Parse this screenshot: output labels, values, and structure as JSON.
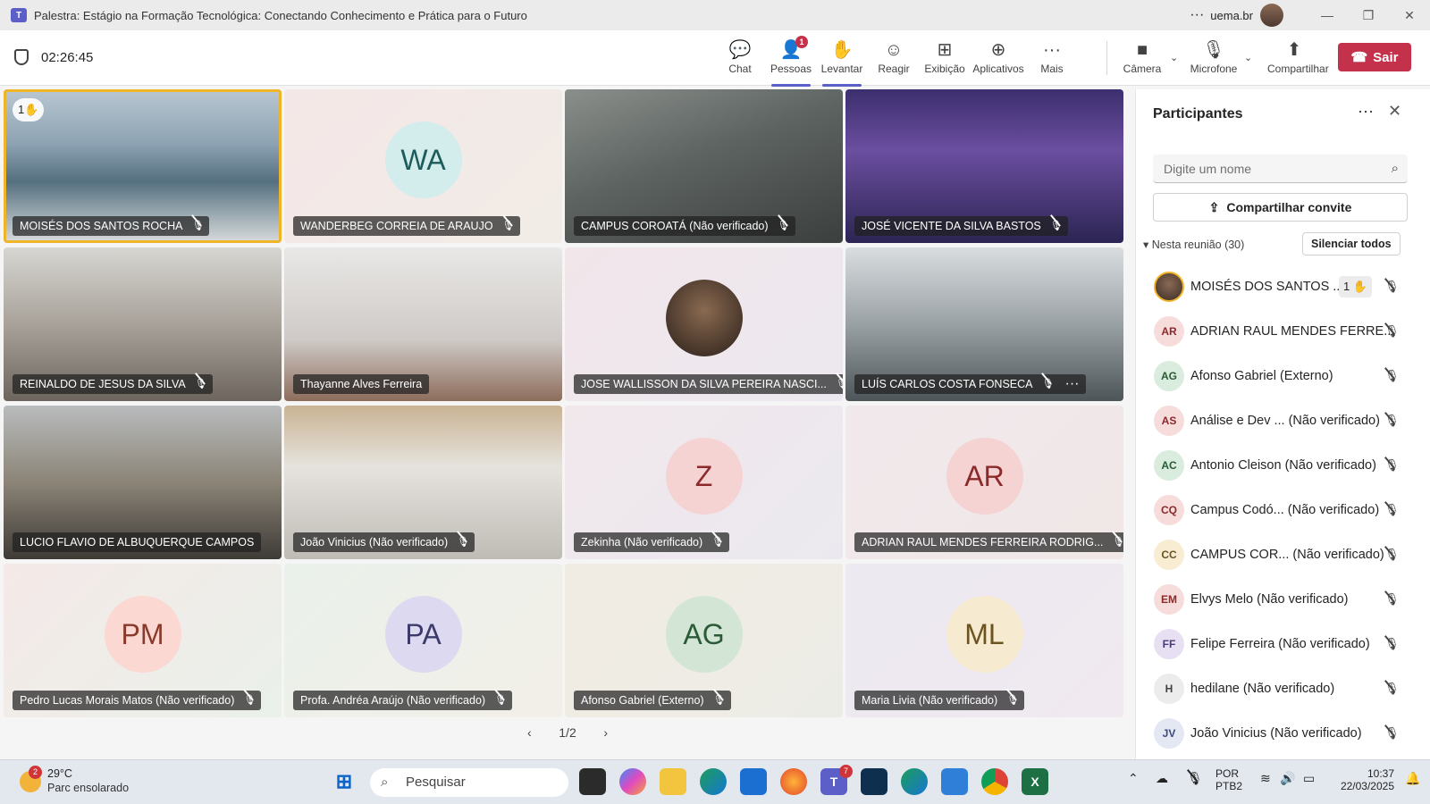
{
  "window": {
    "title": "Palestra: Estágio na Formação Tecnológica: Conectando Conhecimento e Prática para o Futuro",
    "more": "···",
    "org": "uema.br",
    "minimize": "—",
    "maximize": "❐",
    "close": "✕"
  },
  "toolbar": {
    "timer": "02:26:45",
    "buttons": [
      {
        "label": "Chat",
        "icon": "chat-icon",
        "glyph": "💬"
      },
      {
        "label": "Pessoas",
        "icon": "people-icon",
        "glyph": "👤",
        "badge": "1"
      },
      {
        "label": "Levantar",
        "icon": "raise-hand-icon",
        "glyph": "✋"
      },
      {
        "label": "Reagir",
        "icon": "react-icon",
        "glyph": "☺"
      },
      {
        "label": "Exibição",
        "icon": "view-icon",
        "glyph": "⊞"
      },
      {
        "label": "Aplicativos",
        "icon": "apps-icon",
        "glyph": "⊕"
      },
      {
        "label": "Mais",
        "icon": "more-icon",
        "glyph": "···"
      },
      {
        "label": "Câmera",
        "icon": "camera-icon",
        "glyph": "■"
      },
      {
        "label": "Microfone",
        "icon": "mic-off-icon",
        "glyph": "🎙"
      },
      {
        "label": "Compartilhar",
        "icon": "share-icon",
        "glyph": "⬆"
      }
    ],
    "leave_label": "Sair"
  },
  "grid": {
    "tiles": [
      {
        "name": "MOISÉS DOS SANTOS ROCHA",
        "hand": "1✋"
      },
      {
        "name": "WANDERBEG CORREIA DE ARAUJO",
        "initials": "WA"
      },
      {
        "name": "CAMPUS COROATÁ (Não verificado)"
      },
      {
        "name": "JOSÉ VICENTE DA SILVA BASTOS"
      },
      {
        "name": "REINALDO DE JESUS DA SILVA"
      },
      {
        "name": "Thayanne Alves Ferreira"
      },
      {
        "name": "JOSE WALLISSON DA SILVA PEREIRA NASCI..."
      },
      {
        "name": "LUÍS CARLOS COSTA FONSECA",
        "more": "···"
      },
      {
        "name": "LUCIO FLAVIO DE ALBUQUERQUE CAMPOS"
      },
      {
        "name": "João Vinicius (Não verificado)"
      },
      {
        "name": "Zekinha (Não verificado)",
        "initials": "Z"
      },
      {
        "name": "ADRIAN RAUL MENDES FERREIRA RODRIG...",
        "initials": "AR"
      },
      {
        "name": "Pedro Lucas Morais Matos (Não verificado)",
        "initials": "PM"
      },
      {
        "name": "Profa. Andréa Araújo (Não verificado)",
        "initials": "PA"
      },
      {
        "name": "Afonso Gabriel (Externo)",
        "initials": "AG"
      },
      {
        "name": "Maria Livia (Não verificado)",
        "initials": "ML"
      }
    ],
    "pager": {
      "prev": "‹",
      "label": "1/2",
      "next": "›"
    }
  },
  "panel": {
    "title": "Participantes",
    "more": "···",
    "close": "✕",
    "search_placeholder": "Digite um nome",
    "invite_label": "Compartilhar convite",
    "section_label": "Nesta reunião (30)",
    "mute_all": "Silenciar todos",
    "participants": [
      {
        "initials": "",
        "name": "MOISÉS DOS SANTOS ...",
        "hand": "1 ✋"
      },
      {
        "initials": "AR",
        "name": "ADRIAN RAUL MENDES FERRE..."
      },
      {
        "initials": "AG",
        "name": "Afonso Gabriel (Externo)"
      },
      {
        "initials": "AS",
        "name": "Análise e Dev ... (Não verificado)"
      },
      {
        "initials": "AC",
        "name": "Antonio Cleison (Não verificado)"
      },
      {
        "initials": "CQ",
        "name": "Campus Codó... (Não verificado)"
      },
      {
        "initials": "CC",
        "name": "CAMPUS COR... (Não verificado)"
      },
      {
        "initials": "EM",
        "name": "Elvys Melo (Não verificado)"
      },
      {
        "initials": "FF",
        "name": "Felipe Ferreira (Não verificado)"
      },
      {
        "initials": "H",
        "name": "hedilane (Não verificado)"
      },
      {
        "initials": "JV",
        "name": "João Vinicius (Não verificado)"
      }
    ]
  },
  "taskbar": {
    "weather_badge": "2",
    "temperature": "29°C",
    "condition": "Parc ensolarado",
    "search_label": "Pesquisar",
    "teams_badge": "7",
    "lang1": "POR",
    "lang2": "PTB2",
    "time": "10:37",
    "date": "22/03/2025"
  },
  "colors": {
    "accent": "#5b5fc7",
    "leave": "#c4314b",
    "selected_outline": "#f0b429"
  }
}
